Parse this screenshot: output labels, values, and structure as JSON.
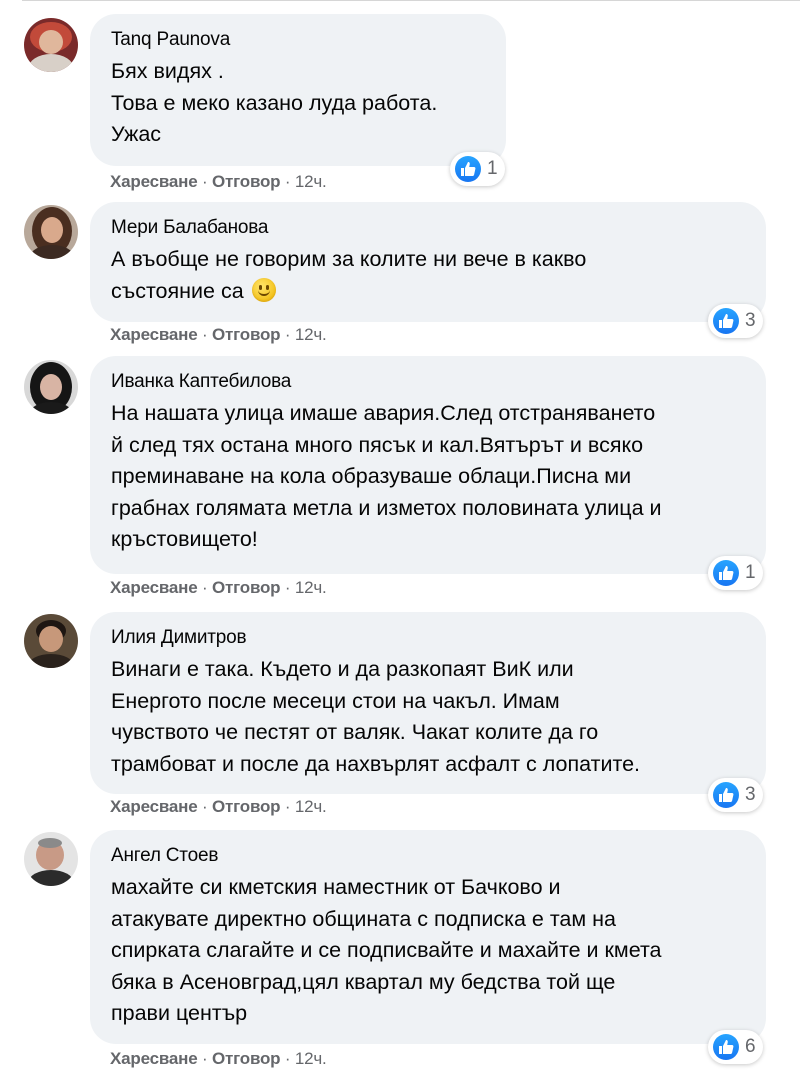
{
  "comments": [
    {
      "author": "Tanq Paunova",
      "lines": [
        "Бях видях .",
        "Това е меко казано луда работа.",
        "Ужас"
      ],
      "like": "Харесване",
      "reply": "Отговор",
      "time": "12ч.",
      "reactions": "1"
    },
    {
      "author": "Мери Балабанова",
      "lines": [
        "А въобще не говорим за колите ни вече в какво",
        "състояние са"
      ],
      "like": "Харесване",
      "reply": "Отговор",
      "time": "12ч.",
      "reactions": "3"
    },
    {
      "author": "Иванка Каптебилова",
      "lines": [
        "На нашата улица имаше авария.След отстраняването",
        "й след тях остана много пясък и кал.Вятърът и всяко",
        "преминаване на кола образуваше облаци.Писна ми",
        "грабнах голямата метла и изметох половината улица и",
        "кръстовището!"
      ],
      "like": "Харесване",
      "reply": "Отговор",
      "time": "12ч.",
      "reactions": "1"
    },
    {
      "author": "Илия Димитров",
      "lines": [
        "Винаги е така. Където и да разкопаят ВиК или",
        "Енергото после месеци стои на чакъл. Имам",
        "чувството че пестят от валяк. Чакат колите да го",
        "трамбоват и после да нахвърлят асфалт с лопатите."
      ],
      "like": "Харесване",
      "reply": "Отговор",
      "time": "12ч.",
      "reactions": "3"
    },
    {
      "author": "Ангел Стоев",
      "lines": [
        "махайте си кметския наместник от Бачково и",
        "атакувате директно общината с подписка е там на",
        "спирката слагайте и се подписвайте и махайте и кмета",
        "бяка в Асеновград,цял квартал му бедства той ще",
        "прави център"
      ],
      "like": "Харесване",
      "reply": "Отговор",
      "time": "12ч.",
      "reactions": "6"
    }
  ],
  "icons": {
    "like_reaction": "thumbs-up-icon",
    "emoji": "slightly-smiling-face-icon"
  },
  "colors": {
    "bubble": "#eff2f5",
    "meta_text": "#65676b",
    "like_blue": "#1876f2"
  }
}
